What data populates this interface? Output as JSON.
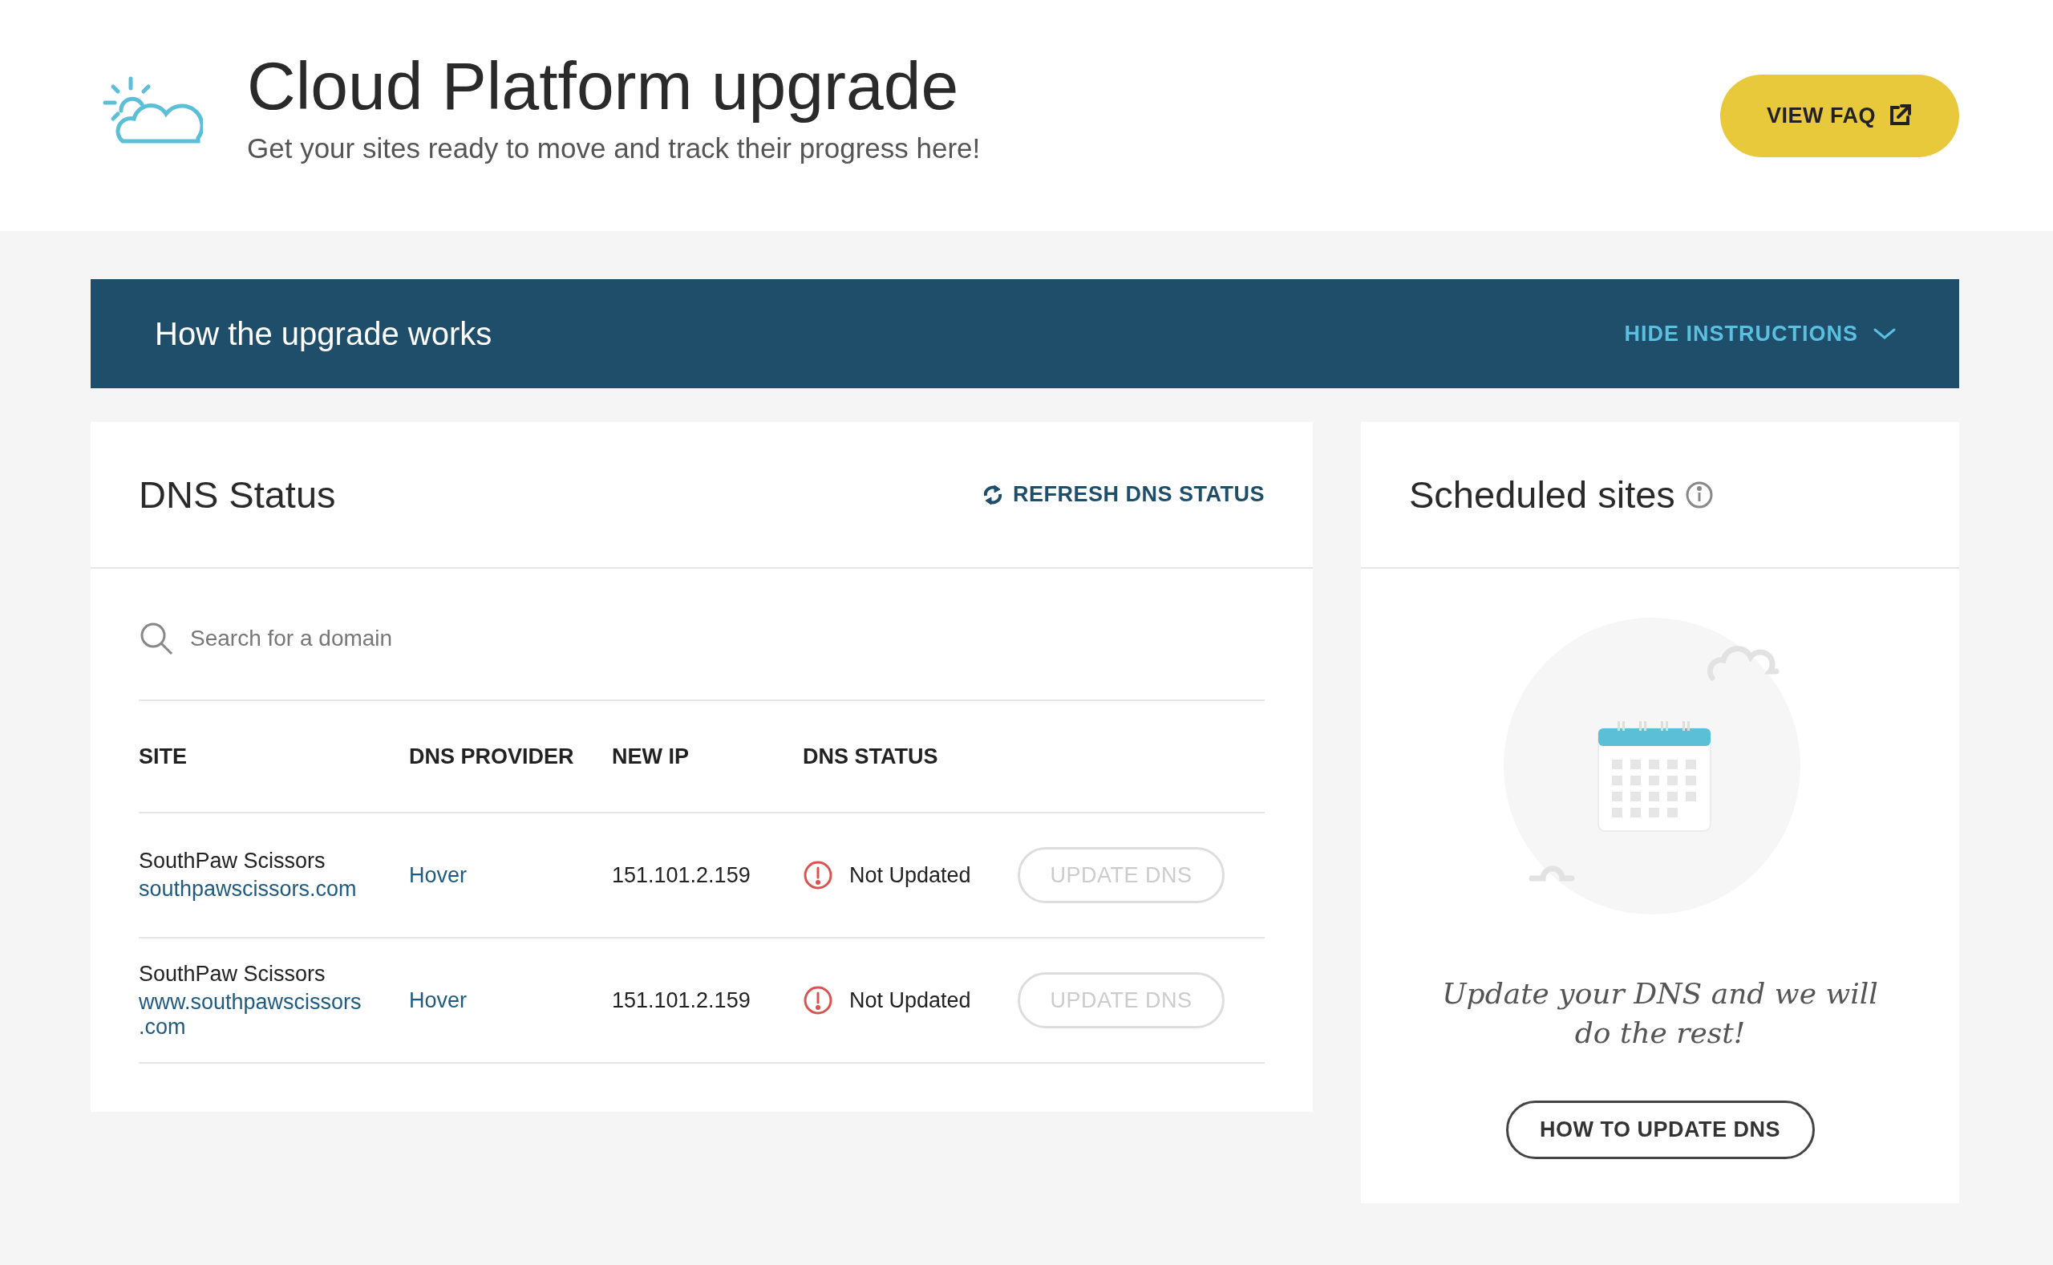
{
  "header": {
    "title": "Cloud Platform upgrade",
    "subtitle": "Get your sites ready to move and track their progress here!",
    "faq_button": "VIEW FAQ"
  },
  "instructions": {
    "title": "How the upgrade works",
    "toggle": "HIDE INSTRUCTIONS",
    "expanded": true
  },
  "dns_status": {
    "title": "DNS Status",
    "refresh": "REFRESH DNS STATUS",
    "search": {
      "placeholder": "Search for a domain"
    },
    "columns": [
      "SITE",
      "DNS PROVIDER",
      "NEW IP",
      "DNS STATUS"
    ],
    "rows": [
      {
        "site": "SouthPaw Scissors",
        "domain": "southpawscissors.com",
        "provider": "Hover",
        "ip": "151.101.2.159",
        "status": "Not Updated",
        "button": "UPDATE DNS",
        "disabled": true
      },
      {
        "site": "SouthPaw Scissors",
        "domain": "www.southpawscissors",
        "domain_cont": ".com",
        "provider": "Hover",
        "ip": "151.101.2.159",
        "status": "Not Updated",
        "button": "UPDATE DNS",
        "disabled": true
      }
    ]
  },
  "scheduled": {
    "title": "Scheduled sites",
    "message": "Update your DNS and we will do the rest!",
    "button": "HOW TO UPDATE DNS"
  }
}
